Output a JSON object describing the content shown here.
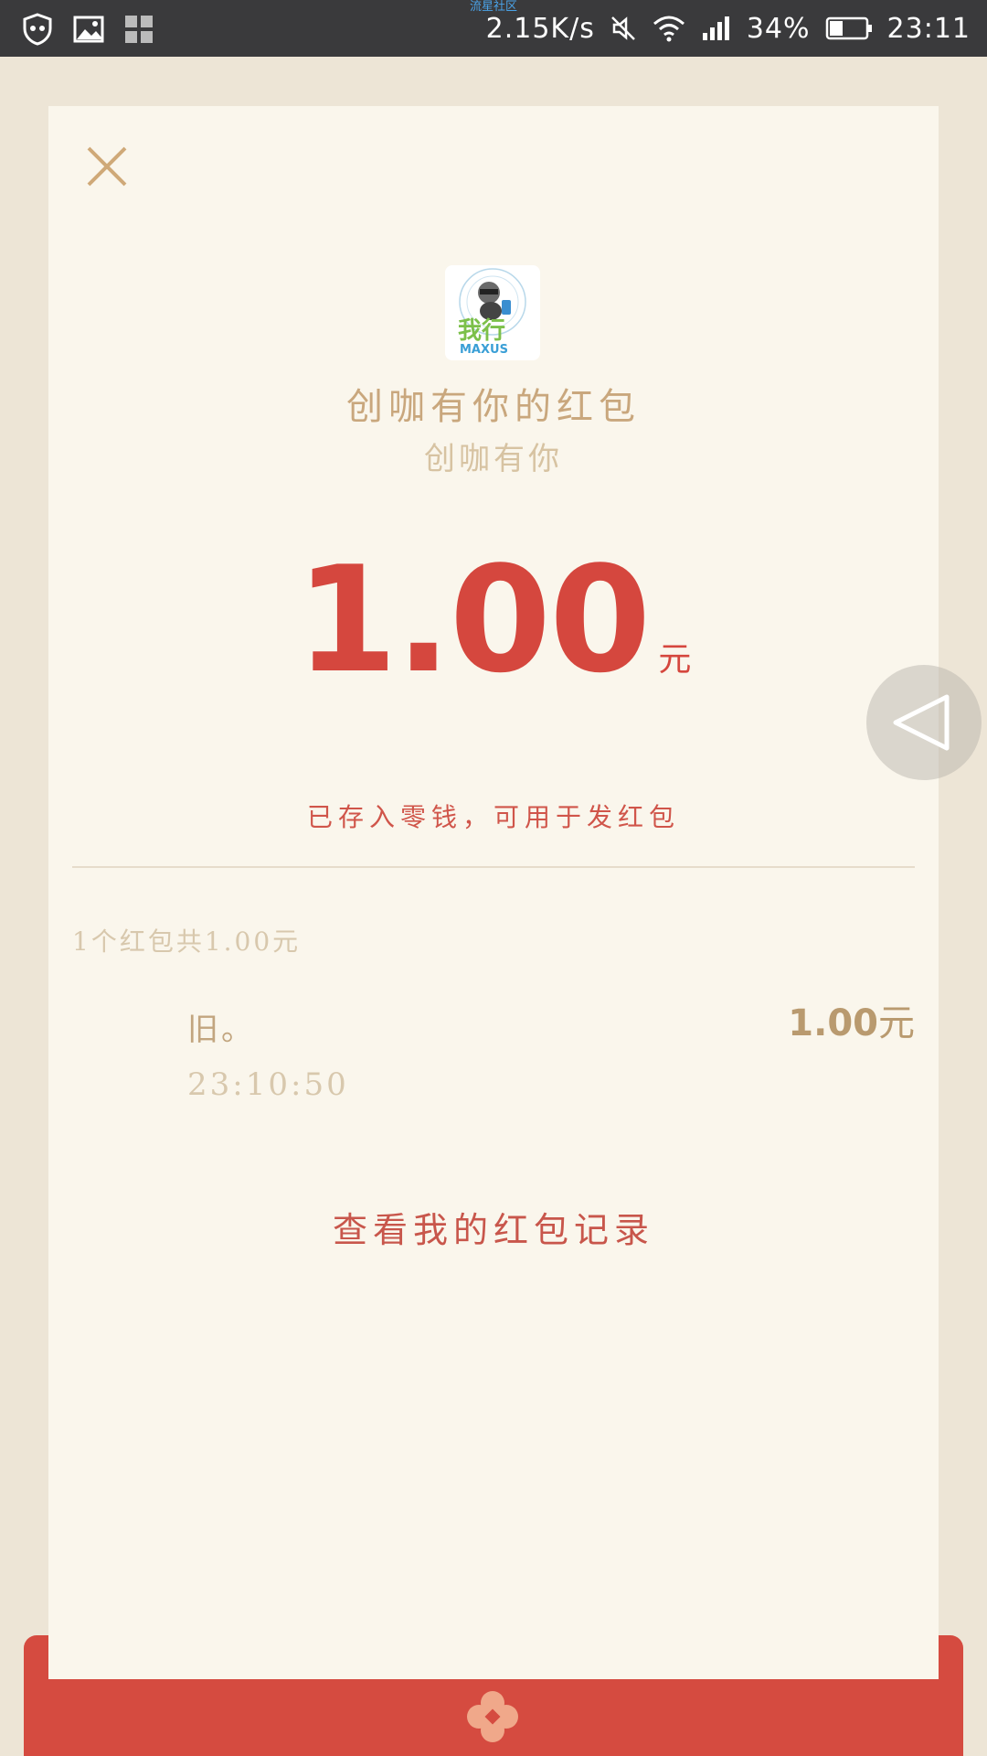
{
  "status_bar": {
    "community_label": "流星社区",
    "speed": "2.15K/s",
    "battery": "34%",
    "time": "23:11",
    "icons": [
      "shield-icon",
      "image-icon",
      "apps-icon",
      "mute-icon",
      "wifi-icon",
      "signal-icon",
      "battery-icon"
    ]
  },
  "header": {
    "close_icon": "close-icon",
    "logo_text": "我行",
    "logo_subtext": "MAXUS"
  },
  "packet": {
    "title": "创咖有你的红包",
    "subtitle": "创咖有你",
    "amount": "1.00",
    "unit": "元",
    "saved_text": "已存入零钱，可用于发红包"
  },
  "records": {
    "summary": "1个红包共1.00元",
    "items": [
      {
        "name": "旧。",
        "time": "23:10:50",
        "amount": "1.00",
        "unit": "元"
      }
    ]
  },
  "footer": {
    "view_records": "查看我的红包记录"
  },
  "colors": {
    "accent_red": "#d5473e",
    "gold": "#c9a77d",
    "card_bg": "#faf6ec",
    "page_bg": "#ede5d6",
    "envelope": "#d54b40"
  }
}
